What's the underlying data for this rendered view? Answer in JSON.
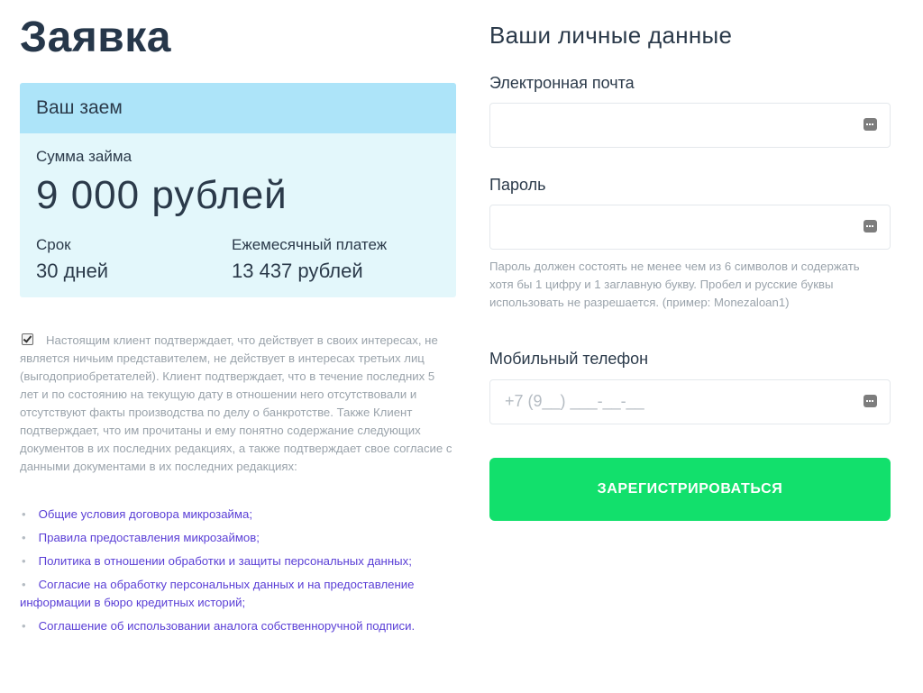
{
  "page_title": "Заявка",
  "loan": {
    "header": "Ваш заем",
    "sum_label": "Сумма займа",
    "sum_value": "9 000 рублей",
    "term_label": "Срок",
    "term_value": "30 дней",
    "payment_label": "Ежемесячный платеж",
    "payment_value": "13 437 рублей"
  },
  "consent": {
    "checked": true,
    "text": "Настоящим клиент подтверждает, что действует в своих интересах, не является ничьим представителем, не действует в интересах третьих лиц (выгодоприобретателей). Клиент подтверждает, что в течение последних 5 лет и по состоянию на текущую дату в отношении него отсутствовали и отсутствуют факты производства по делу о банкротстве. Также Клиент подтверждает, что им прочитаны и ему понятно содержание следующих документов в их последних редакциях, а также подтверждает свое согласие с данными документами в их последних редакциях:",
    "documents": [
      {
        "label": "Общие условия договора микрозайма",
        "suffix": ";"
      },
      {
        "label": "Правила предоставления микрозаймов",
        "suffix": ";"
      },
      {
        "label": "Политика в отношении обработки и защиты персональных данных",
        "suffix": ";"
      },
      {
        "label": "Согласие на обработку персональных данных и на предоставление информации в бюро кредитных историй",
        "suffix": ";"
      },
      {
        "label": "Соглашение об использовании аналога собственноручной подписи",
        "suffix": "."
      }
    ]
  },
  "form": {
    "title": "Ваши личные данные",
    "email_label": "Электронная почта",
    "email_value": "",
    "password_label": "Пароль",
    "password_value": "",
    "password_hint": "Пароль должен состоять не менее чем из 6 символов и содержать хотя бы 1 цифру и 1 заглавную букву. Пробел и русские буквы использовать не разрешается. (пример: Monezaloan1)",
    "phone_label": "Мобильный телефон",
    "phone_placeholder": "+7 (9__) ___-__-__",
    "submit_label": "ЗАРЕГИСТРИРОВАТЬСЯ"
  },
  "colors": {
    "accent_button": "#12e06c",
    "loan_header_bg": "#ade4f9",
    "loan_body_bg": "#e3f7fb",
    "link": "#5a3fd6"
  }
}
